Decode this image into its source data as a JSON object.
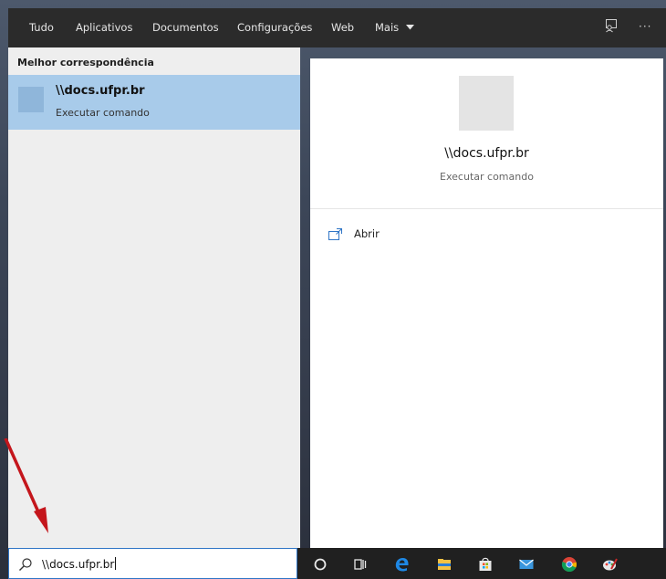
{
  "topbar": {
    "tabs": [
      "Tudo",
      "Aplicativos",
      "Documentos",
      "Configurações",
      "Web",
      "Mais"
    ],
    "more_chevron_icon": "chevron-down-icon",
    "feedback_icon": "feedback-icon",
    "ellipsis": "···"
  },
  "left": {
    "section_title": "Melhor correspondência",
    "best_match": {
      "title": "\\\\docs.ufpr.br",
      "subtitle": "Executar comando"
    }
  },
  "right": {
    "title": "\\\\docs.ufpr.br",
    "subtitle": "Executar comando",
    "actions": [
      {
        "label": "Abrir",
        "icon": "open-window-icon"
      }
    ]
  },
  "search": {
    "value": "\\\\docs.ufpr.br",
    "icon": "search-icon"
  },
  "taskbar": {
    "icons": [
      "cortana-icon",
      "task-view-icon",
      "edge-icon",
      "file-explorer-icon",
      "store-icon",
      "mail-icon",
      "chrome-icon",
      "paint-icon"
    ]
  },
  "colors": {
    "selection": "#a8cbea",
    "search_border": "#2f75c6",
    "arrow": "#c4161c"
  }
}
